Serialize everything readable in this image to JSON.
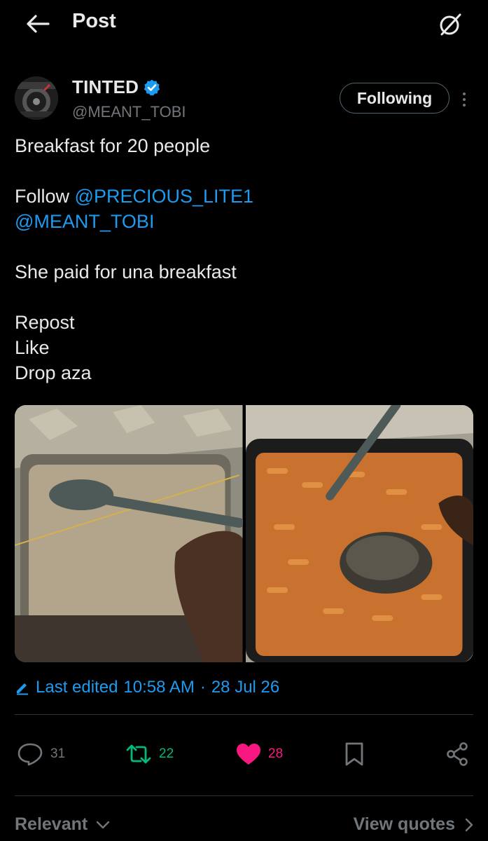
{
  "header": {
    "title": "Post",
    "back_icon": "arrow-left-icon",
    "grok_icon": "grok-icon"
  },
  "author": {
    "display_name": "TINTED",
    "handle": "@MEANT_TOBI",
    "verified": true,
    "follow_label": "Following"
  },
  "post": {
    "line1": "Breakfast for 20 people",
    "follow_word": "Follow",
    "mention1": "@PRECIOUS_LITE1",
    "mention2": "@MEANT_TOBI",
    "line4": "She paid for una breakfast",
    "line5": "Repost",
    "line6": "Like",
    "line7": "Drop aza"
  },
  "edited": {
    "label": "Last edited",
    "time": "10:58 AM",
    "separator": "·",
    "date": "28 Jul 26"
  },
  "stats": {
    "replies": "31",
    "reposts": "22",
    "likes": "28"
  },
  "bottom": {
    "sort_label": "Relevant",
    "view_quotes": "View quotes"
  },
  "colors": {
    "accent": "#1d9bf0",
    "repost": "#00ba7c",
    "like": "#f91880",
    "muted": "#71767b"
  }
}
